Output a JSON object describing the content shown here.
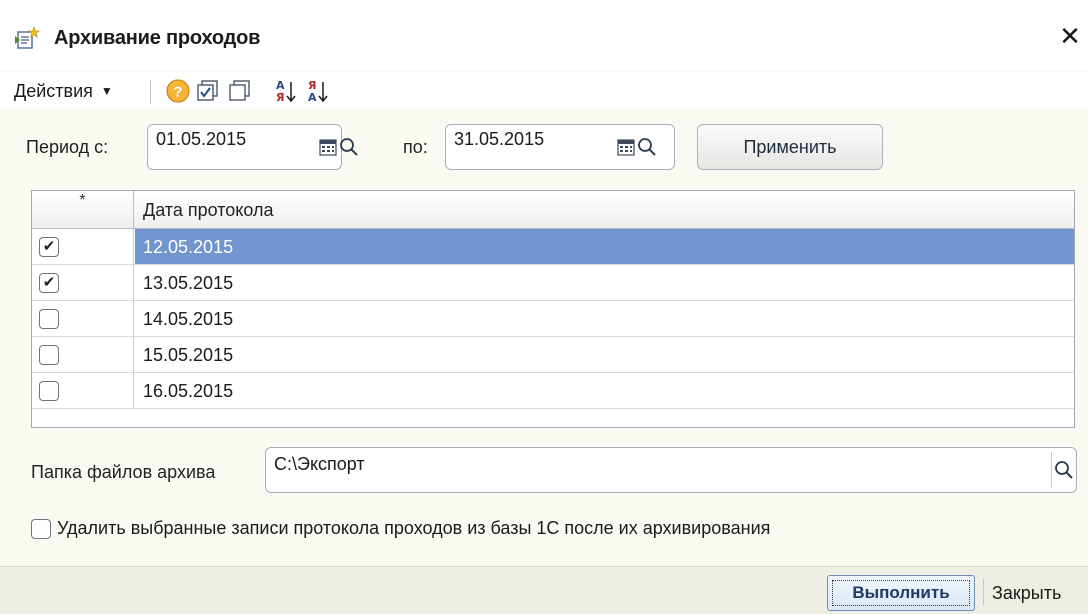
{
  "window": {
    "title": "Архивание проходов",
    "close_glyph": "✕",
    "icon": "archive-document-icon"
  },
  "toolbar": {
    "actions_label": "Действия",
    "buttons": [
      "help-icon",
      "check-all-icon",
      "uncheck-all-icon",
      "sort-ascending-icon",
      "sort-descending-icon"
    ]
  },
  "period": {
    "from_label": "Период с:",
    "from_value": "01.05.2015",
    "to_label": "по:",
    "to_value": "31.05.2015",
    "apply_label": "Применить"
  },
  "table": {
    "col_mark": "*",
    "col_date": "Дата протокола",
    "rows": [
      {
        "checked": true,
        "date": "12.05.2015",
        "selected": true
      },
      {
        "checked": true,
        "date": "13.05.2015",
        "selected": false
      },
      {
        "checked": false,
        "date": "14.05.2015",
        "selected": false
      },
      {
        "checked": false,
        "date": "15.05.2015",
        "selected": false
      },
      {
        "checked": false,
        "date": "16.05.2015",
        "selected": false
      }
    ]
  },
  "archive": {
    "folder_label": "Папка файлов архива",
    "folder_value": "C:\\Экспорт"
  },
  "delete_option": {
    "checked": false,
    "label": "Удалить выбранные записи протокола проходов из базы 1С после их архивирования"
  },
  "footer": {
    "execute_label": "Выполнить",
    "close_label": "Закрыть"
  },
  "colors": {
    "selection": "#7196cd",
    "window_bg": "#fbfaf2",
    "footer_bg": "#efeee2"
  }
}
